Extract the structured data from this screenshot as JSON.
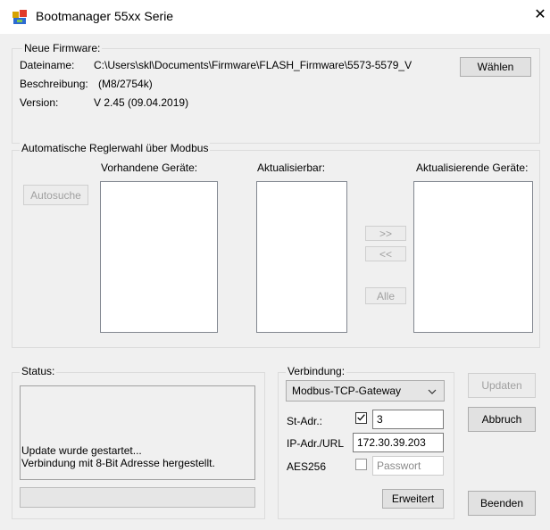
{
  "window": {
    "title": "Bootmanager 55xx Serie",
    "close_glyph": "✕"
  },
  "firmware": {
    "group_label": "Neue Firmware:",
    "filename_label": "Dateiname:",
    "filename_value": "C:\\Users\\skl\\Documents\\Firmware\\FLASH_Firmware\\5573-5579_V",
    "choose_button": "Wählen",
    "description_label": "Beschreibung:",
    "description_value": "(M8/2754k)",
    "version_label": "Version:",
    "version_value": "V 2.45 (09.04.2019)"
  },
  "modbus": {
    "group_label": "Automatische Reglerwahl über Modbus",
    "autosearch_button": "Autosuche",
    "existing_label": "Vorhandene Geräte:",
    "updatable_label": "Aktualisierbar:",
    "updating_label": "Aktualisierende Geräte:",
    "move_right_button": ">>",
    "move_left_button": "<<",
    "all_button": "Alle"
  },
  "status": {
    "label": "Status:",
    "lines": [
      "Update wurde gestartet...",
      "Verbindung mit 8-Bit Adresse hergestellt."
    ],
    "progress": 0
  },
  "connection": {
    "label": "Verbindung:",
    "type_selected": "Modbus-TCP-Gateway",
    "st_adr_label": "St-Adr.:",
    "st_adr_checked": true,
    "st_adr_value": "3",
    "ip_label": "IP-Adr./URL",
    "ip_value": "172.30.39.203",
    "aes_label": "AES256",
    "aes_checked": false,
    "password_placeholder": "Passwort",
    "extended_button": "Erweitert"
  },
  "actions": {
    "update_button": "Updaten",
    "abort_button": "Abbruch",
    "exit_button": "Beenden"
  }
}
